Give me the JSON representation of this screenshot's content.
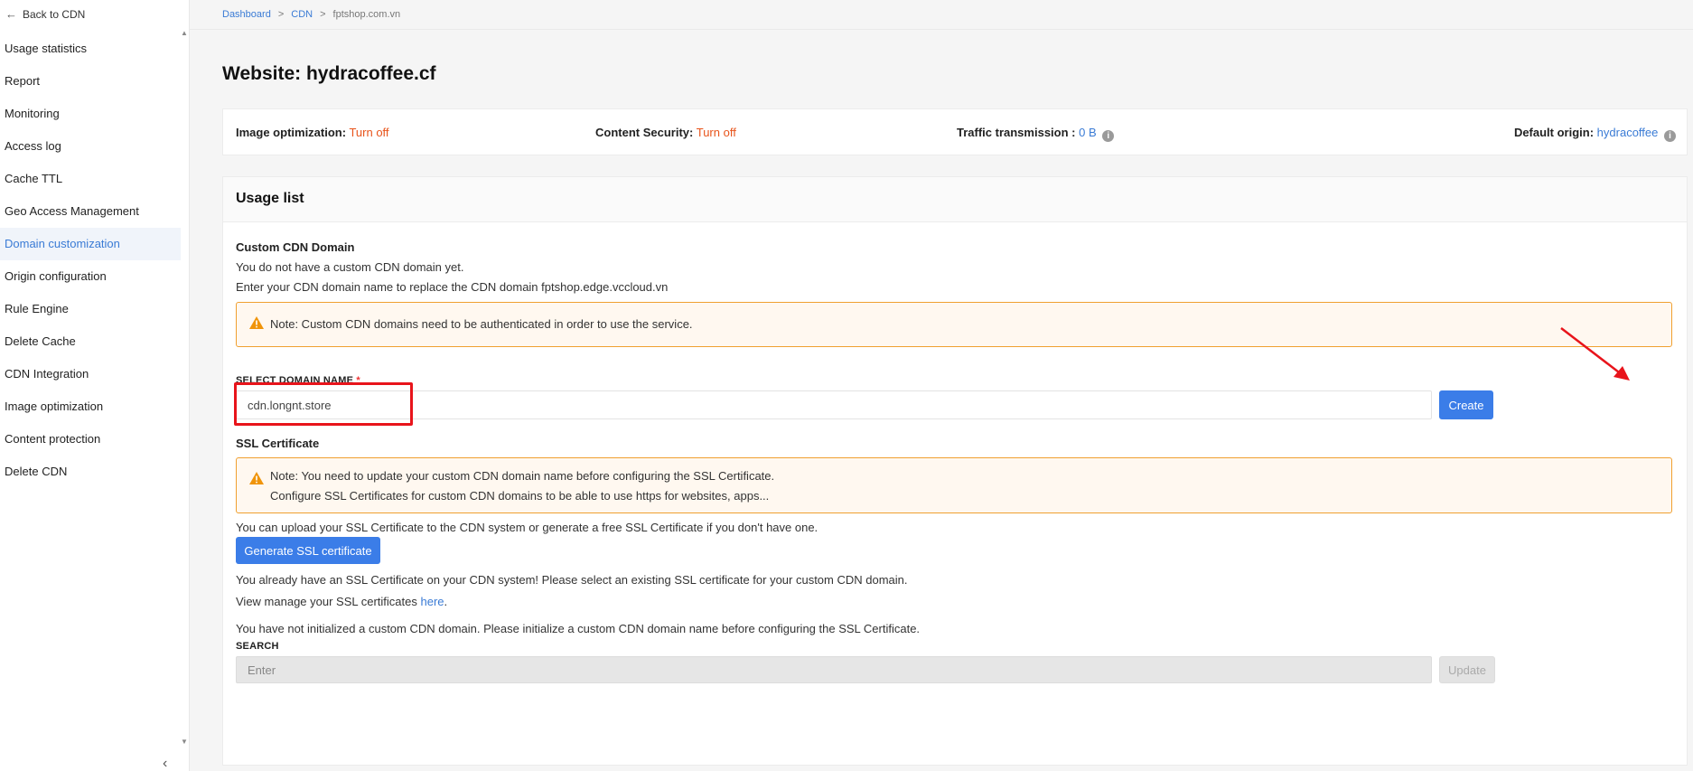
{
  "sidebar": {
    "back_label": "Back to CDN",
    "items": [
      {
        "label": "Usage statistics"
      },
      {
        "label": "Report"
      },
      {
        "label": "Monitoring"
      },
      {
        "label": "Access log"
      },
      {
        "label": "Cache TTL"
      },
      {
        "label": "Geo Access Management"
      },
      {
        "label": "Domain customization",
        "active": true
      },
      {
        "label": "Origin configuration"
      },
      {
        "label": "Rule Engine"
      },
      {
        "label": "Delete Cache"
      },
      {
        "label": "CDN Integration"
      },
      {
        "label": "Image optimization"
      },
      {
        "label": "Content protection"
      },
      {
        "label": "Delete CDN"
      }
    ]
  },
  "breadcrumb": {
    "dashboard": "Dashboard",
    "cdn": "CDN",
    "current": "fptshop.com.vn",
    "separator": ">"
  },
  "page": {
    "title": "Website: hydracoffee.cf"
  },
  "info_bar": {
    "image_opt_label": "Image optimization:",
    "image_opt_value": "Turn off",
    "content_sec_label": "Content Security:",
    "content_sec_value": "Turn off",
    "traffic_label": "Traffic transmission :",
    "traffic_value": "0 B",
    "origin_label": "Default origin:",
    "origin_value": "hydracoffee"
  },
  "usage": {
    "header": "Usage list",
    "custom_domain_title": "Custom CDN Domain",
    "no_domain_text": "You do not have a custom CDN domain yet.",
    "replace_text": "Enter your CDN domain name to replace the CDN domain fptshop.edge.vccloud.vn",
    "note1": "Note: Custom CDN domains need to be authenticated in order to use the service.",
    "select_label": "SELECT DOMAIN NAME",
    "required_mark": "*",
    "domain_value": "cdn.longnt.store",
    "create_label": "Create",
    "ssl_title": "SSL Certificate",
    "note2_line1": "Note: You need to update your custom CDN domain name before configuring the SSL Certificate.",
    "note2_line2": "Configure SSL Certificates for custom CDN domains to be able to use https for websites, apps...",
    "upload_text": "You can upload your SSL Certificate to the CDN system or generate a free SSL Certificate if you don't have one.",
    "generate_label": "Generate SSL certificate",
    "already_text": "You already have an SSL Certificate on your CDN system! Please select an existing SSL certificate for your custom CDN domain.",
    "view_manage_text": "View manage your SSL certificates ",
    "here_link": "here",
    "period": ".",
    "not_init_text": "You have not initialized a custom CDN domain. Please initialize a custom CDN domain name before configuring the SSL Certificate.",
    "search_label": "SEARCH",
    "search_placeholder": "Enter",
    "update_label": "Update"
  },
  "colors": {
    "accent": "#3b7de8",
    "warning": "#e8541b",
    "annotation": "#e8141b"
  }
}
